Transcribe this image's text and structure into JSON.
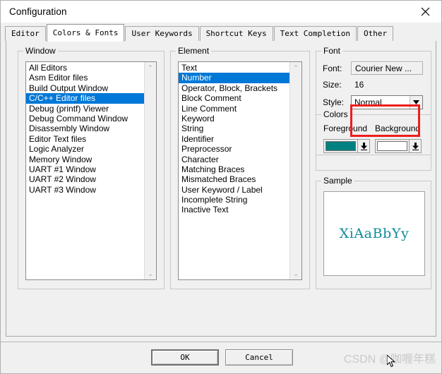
{
  "window": {
    "title": "Configuration",
    "close_icon": "close-icon"
  },
  "tabs": [
    {
      "label": "Editor",
      "active": false
    },
    {
      "label": "Colors & Fonts",
      "active": true
    },
    {
      "label": "User Keywords",
      "active": false
    },
    {
      "label": "Shortcut Keys",
      "active": false
    },
    {
      "label": "Text Completion",
      "active": false
    },
    {
      "label": "Other",
      "active": false
    }
  ],
  "window_group": {
    "label": "Window",
    "items": [
      {
        "label": "All Editors",
        "selected": false
      },
      {
        "label": "Asm Editor files",
        "selected": false
      },
      {
        "label": "Build Output Window",
        "selected": false
      },
      {
        "label": "C/C++ Editor files",
        "selected": true
      },
      {
        "label": "Debug (printf) Viewer",
        "selected": false
      },
      {
        "label": "Debug Command Window",
        "selected": false
      },
      {
        "label": "Disassembly Window",
        "selected": false
      },
      {
        "label": "Editor Text files",
        "selected": false
      },
      {
        "label": "Logic Analyzer",
        "selected": false
      },
      {
        "label": "Memory Window",
        "selected": false
      },
      {
        "label": "UART #1 Window",
        "selected": false
      },
      {
        "label": "UART #2 Window",
        "selected": false
      },
      {
        "label": "UART #3 Window",
        "selected": false
      }
    ]
  },
  "element_group": {
    "label": "Element",
    "items": [
      {
        "label": "Text",
        "selected": false
      },
      {
        "label": "Number",
        "selected": true
      },
      {
        "label": "Operator, Block, Brackets",
        "selected": false
      },
      {
        "label": "Block Comment",
        "selected": false
      },
      {
        "label": "Line Comment",
        "selected": false
      },
      {
        "label": "Keyword",
        "selected": false
      },
      {
        "label": "String",
        "selected": false
      },
      {
        "label": "Identifier",
        "selected": false
      },
      {
        "label": "Preprocessor",
        "selected": false
      },
      {
        "label": "Character",
        "selected": false
      },
      {
        "label": "Matching Braces",
        "selected": false
      },
      {
        "label": "Mismatched Braces",
        "selected": false
      },
      {
        "label": "User Keyword / Label",
        "selected": false
      },
      {
        "label": "Incomplete String",
        "selected": false
      },
      {
        "label": "Inactive Text",
        "selected": false
      }
    ]
  },
  "font_group": {
    "label": "Font",
    "font_label": "Font:",
    "font_value": "Courier New ...",
    "size_label": "Size:",
    "size_value": "16",
    "style_label": "Style:",
    "style_value": "Normal"
  },
  "colors_group": {
    "label": "Colors",
    "foreground_label": "Foreground",
    "background_label": "Background",
    "foreground_color": "#008080",
    "background_color": "#ffffff"
  },
  "sample_group": {
    "label": "Sample",
    "text": "XiAaBbYy",
    "text_color": "#0e8c99",
    "bg_color": "#ffffff"
  },
  "footer": {
    "ok_label": "OK",
    "cancel_label": "Cancel",
    "watermark": "CSDN @咖喱年糕"
  },
  "annotation": {
    "color": "#ef1c1c"
  },
  "scrollbar": {
    "up_glyph": "⌃",
    "down_glyph": "⌄"
  }
}
